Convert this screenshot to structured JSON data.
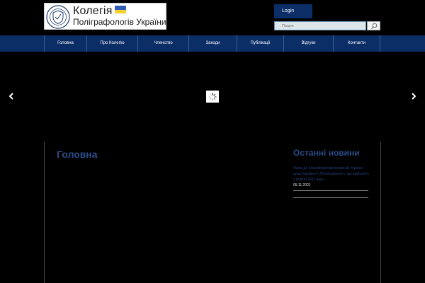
{
  "header": {
    "logo_line1": "Колегія",
    "logo_line2": "Поліграфологів України",
    "login_label": "Login",
    "search": {
      "placeholder": "Пошук"
    }
  },
  "nav": {
    "items": [
      {
        "label": "Головна"
      },
      {
        "label": "Про Колегію"
      },
      {
        "label": "Членство"
      },
      {
        "label": "Заходи"
      },
      {
        "label": "Публікації"
      },
      {
        "label": "Відгуки"
      },
      {
        "label": "Контакти"
      }
    ]
  },
  "slider": {
    "prev_icon": "chevron-left-icon",
    "next_icon": "chevron-right-icon",
    "loader_icon": "spinner-icon"
  },
  "main": {
    "page_title": "Головна"
  },
  "news": {
    "title": "Останні новини",
    "items": [
      {
        "text": "Зміни до Класифікатора професій України щодо професії «Поліграфолог», що відбулися у жовтні 2021 року",
        "date": "05.11.2021"
      }
    ]
  },
  "colors": {
    "brand_navy": "#0b2e67",
    "heading_blue": "#2a4c89",
    "background": "#000000",
    "flag_blue": "#2f5db8",
    "flag_yellow": "#f5d130"
  }
}
